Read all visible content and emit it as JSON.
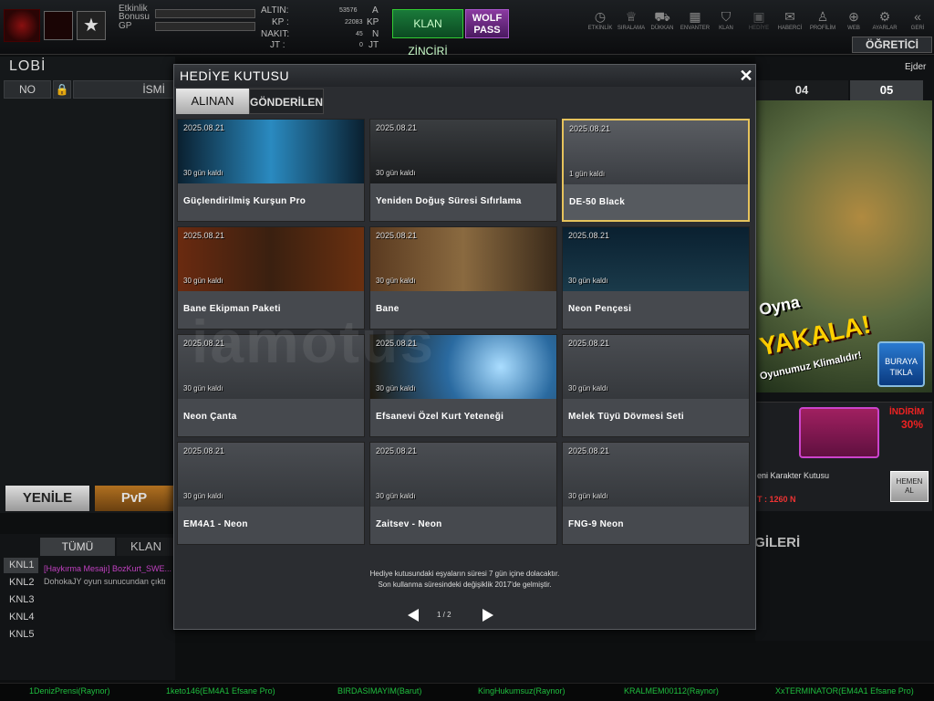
{
  "topbar": {
    "etkinlik_label": "Etkinlik",
    "bonusu_label": "Bonusu",
    "gp_label": "GP",
    "currencies": [
      {
        "label": "ALTIN:",
        "value": "53576",
        "unit": "A"
      },
      {
        "label": "KP :",
        "value": "22083",
        "unit": "KP"
      },
      {
        "label": "NAKIT:",
        "value": "45",
        "unit": "N"
      },
      {
        "label": "JT :",
        "value": "0",
        "unit": "JT"
      }
    ],
    "klan_btn": "KLAN ZİNCİRİ",
    "wolf_btn_1": "WOLF",
    "wolf_btn_2": "PASS",
    "nav": [
      {
        "label": "ETKİNLİK",
        "icon": "clock-icon",
        "glyph": "◷"
      },
      {
        "label": "SIRALAMA",
        "icon": "medal-icon",
        "glyph": "♕"
      },
      {
        "label": "DÜKKAN",
        "icon": "cart-icon",
        "glyph": "⛟"
      },
      {
        "label": "ENVANTER",
        "icon": "inventory-icon",
        "glyph": "▦"
      },
      {
        "label": "KLAN",
        "icon": "shield-icon",
        "glyph": "⛉"
      },
      {
        "label": "HEDİYE",
        "icon": "gift-icon",
        "glyph": "▣"
      },
      {
        "label": "HABERCİ",
        "icon": "megaphone-icon",
        "glyph": "✉"
      },
      {
        "label": "PROFİLİM",
        "icon": "profile-icon",
        "glyph": "♙"
      },
      {
        "label": "WEB",
        "icon": "globe-icon",
        "glyph": "⊕"
      },
      {
        "label": "AYARLAR",
        "icon": "gear-icon",
        "glyph": "⚙"
      },
      {
        "label": "GERİ",
        "icon": "back-icon",
        "glyph": "«"
      }
    ],
    "ogretici": "ÖĞRETİCİ"
  },
  "lobby": {
    "title": "LOBİ",
    "col_no": "NO",
    "col_name": "İSMİ",
    "yenile": "YENİLE",
    "pvp": "PvP",
    "tab_all": "TÜMÜ",
    "tab_clan": "KLAN",
    "channels": [
      "KNL1",
      "KNL2",
      "KNL3",
      "KNL4",
      "KNL5"
    ],
    "chat": [
      {
        "text": "[Haykırma Mesajı] BozKurt_SWE...",
        "color": "#c040c0"
      },
      {
        "text": "DohokaJY oyun sunucundan çıktı",
        "color": "#aaaaaa"
      }
    ]
  },
  "modal": {
    "title": "HEDİYE KUTUSU",
    "tab_received": "ALINAN",
    "tab_sent": "GÖNDERİLEN",
    "items": [
      {
        "date": "2025.08.21",
        "days": "30 gün kaldı",
        "name": "Güçlendirilmiş Kurşun Pro",
        "bg": "linear-gradient(90deg,#0a2030,#2a8ac0,#0a2030)"
      },
      {
        "date": "2025.08.21",
        "days": "30 gün kaldı",
        "name": "Yeniden Doğuş Süresi Sıfırlama",
        "bg": "linear-gradient(#3a3d40,#1a1c1e)"
      },
      {
        "date": "2025.08.21",
        "days": "1 gün kaldı",
        "name": "DE-50 Black",
        "bg": "linear-gradient(#5a5d62,#3a3d42)"
      },
      {
        "date": "2025.08.21",
        "days": "30 gün kaldı",
        "name": "Bane Ekipman Paketi",
        "bg": "linear-gradient(90deg,#6a2a10,#3a2010,#6a3010)"
      },
      {
        "date": "2025.08.21",
        "days": "30 gün kaldı",
        "name": "Bane",
        "bg": "linear-gradient(90deg,#5a3a20,#8a6a40,#3a2a1a)"
      },
      {
        "date": "2025.08.21",
        "days": "30 gün kaldı",
        "name": "Neon Pençesi",
        "bg": "linear-gradient(#0a2030,#1a3a4a)"
      },
      {
        "date": "2025.08.21",
        "days": "30 gün kaldı",
        "name": "Neon Çanta",
        "bg": "linear-gradient(#4a4d52,#35383c)"
      },
      {
        "date": "2025.08.21",
        "days": "30 gün kaldı",
        "name": "Efsanevi Özel Kurt Yeteneği",
        "bg": "radial-gradient(circle at 70% 50%,#aaddff,#2a6aa0 40%,#201a10)"
      },
      {
        "date": "2025.08.21",
        "days": "30 gün kaldı",
        "name": "Melek Tüyü Dövmesi Seti",
        "bg": "linear-gradient(#4a4d52,#35383c)"
      },
      {
        "date": "2025.08.21",
        "days": "30 gün kaldı",
        "name": "EM4A1 - Neon",
        "bg": "linear-gradient(#4a4d52,#35383c)"
      },
      {
        "date": "2025.08.21",
        "days": "30 gün kaldı",
        "name": "Zaitsev - Neon",
        "bg": "linear-gradient(#4a4d52,#35383c)"
      },
      {
        "date": "2025.08.21",
        "days": "30 gün kaldı",
        "name": "FNG-9 Neon",
        "bg": "linear-gradient(#4a4d52,#35383c)"
      }
    ],
    "info_line1": "Hediye kutusundaki eşyaların süresi 7 gün içine dolacaktır.",
    "info_line2": "Son kullanma süresindeki değişiklik 2017'de gelmiştir.",
    "page": "1 / 2"
  },
  "right": {
    "user": "Ejder",
    "tab_04": "04",
    "tab_05": "05",
    "banner_oyna": "Oyna",
    "banner_yakala": "YAKALA!",
    "banner_klima": "Oyunumuz Klimalıdır!",
    "buraya": "BURAYA TIKLA",
    "indirim": "İNDİRİM",
    "pct": "30%",
    "shop_item": "eni Karakter Kutusu",
    "shop_price": "T : 1260 N",
    "hemen": "HEMEN AL",
    "bilgi_title": "LGİLERİ"
  },
  "bottom_players": [
    "1DenizPrensi(Raynor)",
    "1keto146(EM4A1 Efsane Pro)",
    "BIRDASIMAYIM(Barut)",
    "KingHukumsuz(Raynor)",
    "KRALMEM00112(Raynor)",
    "XxTERMINATOR(EM4A1 Efsane Pro)"
  ],
  "watermark": "iamotus"
}
